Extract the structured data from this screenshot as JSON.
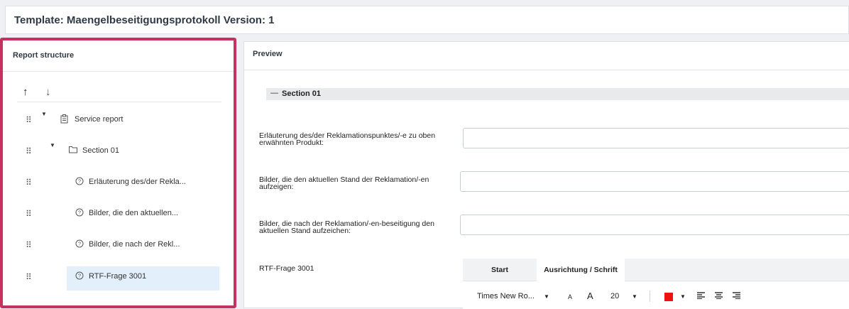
{
  "header": {
    "title": "Template: Maengelbeseitigungsprotokoll Version: 1"
  },
  "structure": {
    "title": "Report structure",
    "sort_up": "↑",
    "sort_down": "↓",
    "drag_glyph": "⠿",
    "items": [
      {
        "label": "Service report",
        "icon": "clipboard-icon",
        "expanded": true
      },
      {
        "label": "Section 01",
        "icon": "folder-icon",
        "expanded": true
      },
      {
        "label": "Erläuterung des/der Rekla...",
        "icon": "question-circle-icon"
      },
      {
        "label": "Bilder, die den aktuellen...",
        "icon": "question-circle-icon"
      },
      {
        "label": "Bilder, die nach der Rekl...",
        "icon": "question-circle-icon"
      },
      {
        "label": "RTF-Frage 3001",
        "icon": "question-circle-icon",
        "selected": true
      }
    ]
  },
  "preview": {
    "title": "Preview",
    "section": {
      "collapse": "—",
      "label": "Section 01"
    },
    "questions": [
      {
        "label": "Erläuterung des/der Reklamationspunktes/-e zu oben erwähnten Produkt:",
        "value": ""
      },
      {
        "label": "Bilder, die den aktuellen Stand der Reklamation/-en aufzeigen:",
        "value": ""
      },
      {
        "label": "Bilder, die nach der Reklamation/-en-beseitigung den aktuellen Stand aufzeichen:",
        "value": ""
      }
    ],
    "rtf": {
      "label": "RTF-Frage 3001",
      "tabs": [
        {
          "label": "Start"
        },
        {
          "label": "Ausrichtung / Schrift",
          "active": true
        }
      ],
      "font_name": "Times New Ro...",
      "font_size": "20",
      "grow": "A",
      "shrink": "A",
      "font_color": "#ee1111"
    }
  },
  "colors": {
    "highlight_border": "#c4325f",
    "selected_row": "#e3effa"
  }
}
